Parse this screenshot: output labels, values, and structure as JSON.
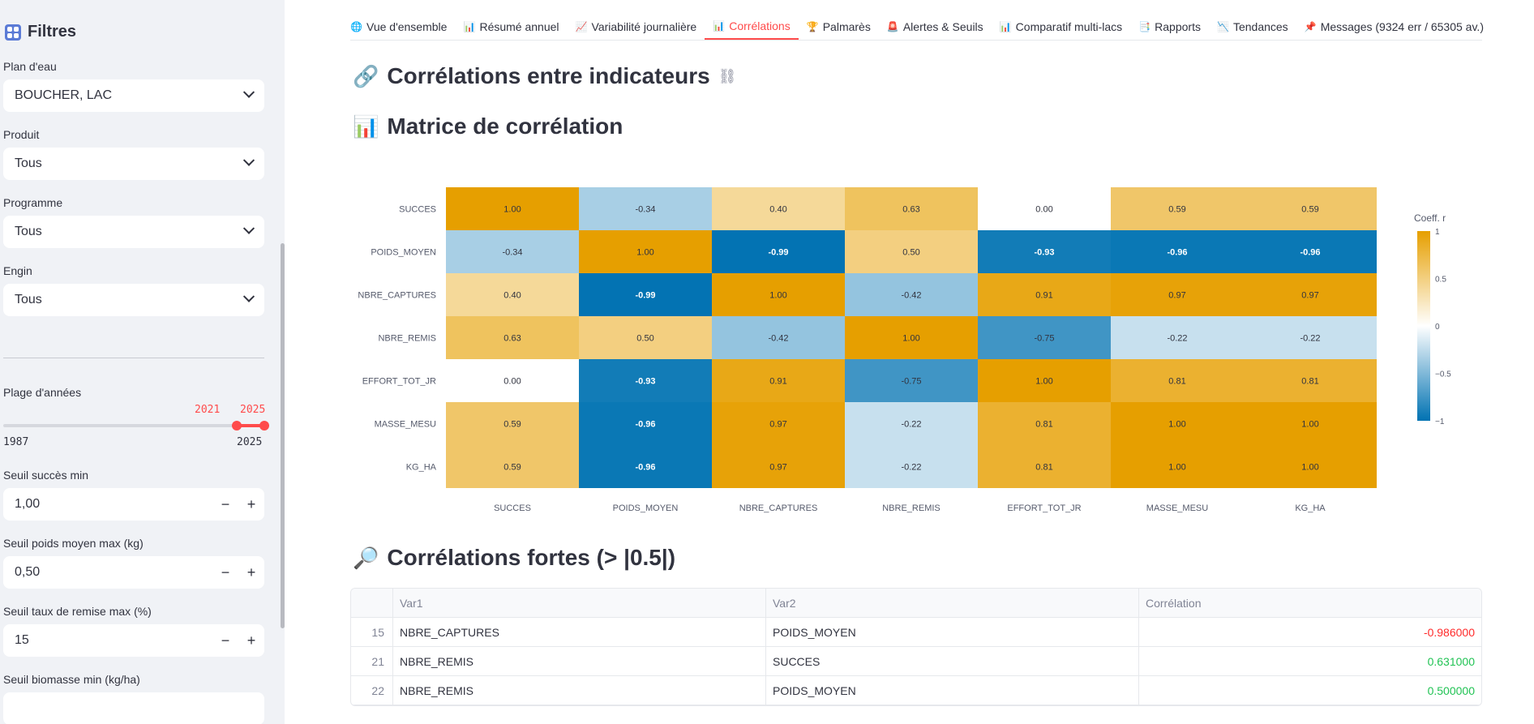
{
  "sidebar": {
    "title": "Filtres",
    "plan_label": "Plan d'eau",
    "plan_value": "BOUCHER, LAC",
    "produit_label": "Produit",
    "produit_value": "Tous",
    "programme_label": "Programme",
    "programme_value": "Tous",
    "engin_label": "Engin",
    "engin_value": "Tous",
    "years_label": "Plage d'années",
    "years_low": "2021",
    "years_high": "2025",
    "years_min": "1987",
    "years_max": "2025",
    "years_range_fraction": [
      0.895,
      1.0
    ],
    "succes_label": "Seuil succès min",
    "succes_value": "1,00",
    "poids_label": "Seuil poids moyen max (kg)",
    "poids_value": "0,50",
    "remise_label": "Seuil taux de remise max (%)",
    "remise_value": "15",
    "biomasse_label": "Seuil biomasse min (kg/ha)",
    "minus": "−",
    "plus": "+"
  },
  "tabs": [
    {
      "icon": "globe-icon",
      "label": "Vue d'ensemble"
    },
    {
      "icon": "bar-chart-icon",
      "label": "Résumé annuel"
    },
    {
      "icon": "line-chart-icon",
      "label": "Variabilité journalière"
    },
    {
      "icon": "bar-chart-icon",
      "label": "Corrélations",
      "active": true
    },
    {
      "icon": "trophy-icon",
      "label": "Palmarès"
    },
    {
      "icon": "siren-icon",
      "label": "Alertes & Seuils"
    },
    {
      "icon": "bar-chart-icon",
      "label": "Comparatif multi-lacs"
    },
    {
      "icon": "report-icon",
      "label": "Rapports"
    },
    {
      "icon": "trend-down-icon",
      "label": "Tendances"
    },
    {
      "icon": "pin-icon",
      "label": "Messages (9324 err / 65305 av.)"
    }
  ],
  "main": {
    "title": "Corrélations entre indicateurs",
    "matrix_title": "Matrice de corrélation",
    "strong_title": "Corrélations fortes (> |0.5|)"
  },
  "chart_data": {
    "type": "heatmap",
    "categories": [
      "SUCCES",
      "POIDS_MOYEN",
      "NBRE_CAPTURES",
      "NBRE_REMIS",
      "EFFORT_TOT_JR",
      "MASSE_MESU",
      "KG_HA"
    ],
    "values": [
      [
        1.0,
        -0.34,
        0.4,
        0.63,
        0.0,
        0.59,
        0.59
      ],
      [
        -0.34,
        1.0,
        -0.99,
        0.5,
        -0.93,
        -0.96,
        -0.96
      ],
      [
        0.4,
        -0.99,
        1.0,
        -0.42,
        0.91,
        0.97,
        0.97
      ],
      [
        0.63,
        0.5,
        -0.42,
        1.0,
        -0.75,
        -0.22,
        -0.22
      ],
      [
        0.0,
        -0.93,
        0.91,
        -0.75,
        1.0,
        0.81,
        0.81
      ],
      [
        0.59,
        -0.96,
        0.97,
        -0.22,
        0.81,
        1.0,
        1.0
      ],
      [
        0.59,
        -0.96,
        0.97,
        -0.22,
        0.81,
        1.0,
        1.0
      ]
    ],
    "colorbar_title": "Coeff. r",
    "colorbar_ticks": [
      "1",
      "0.5",
      "0",
      "−0.5",
      "−1"
    ],
    "zrange": [
      -1,
      1
    ],
    "colors": {
      "high": "#e69f00",
      "mid": "#ffffff",
      "low": "#0072b2"
    }
  },
  "table": {
    "headers": [
      "",
      "Var1",
      "Var2",
      "Corrélation"
    ],
    "rows": [
      {
        "idx": "15",
        "var1": "NBRE_CAPTURES",
        "var2": "POIDS_MOYEN",
        "corr": "-0.986000",
        "sign": "neg"
      },
      {
        "idx": "21",
        "var1": "NBRE_REMIS",
        "var2": "SUCCES",
        "corr": "0.631000",
        "sign": "pos"
      },
      {
        "idx": "22",
        "var1": "NBRE_REMIS",
        "var2": "POIDS_MOYEN",
        "corr": "0.500000",
        "sign": "pos"
      }
    ]
  }
}
